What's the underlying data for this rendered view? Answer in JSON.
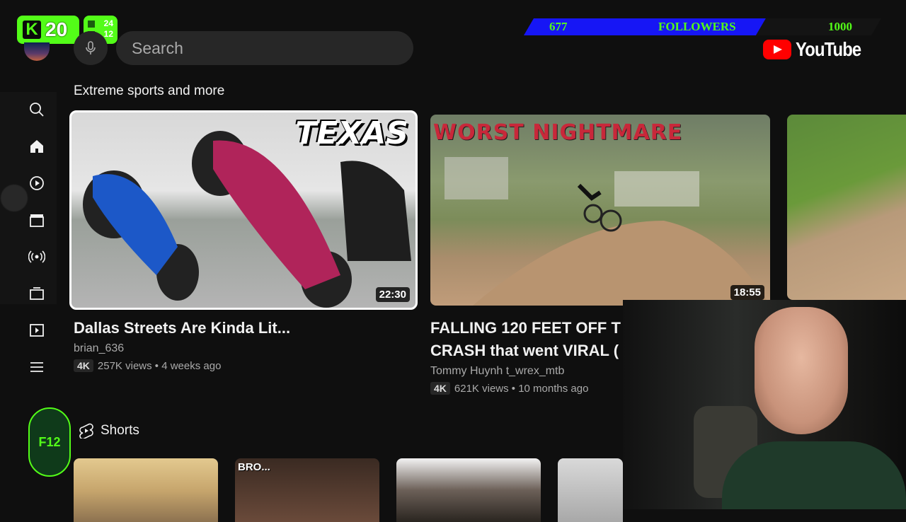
{
  "overlay": {
    "kick_count": "20",
    "stats_top": "24",
    "stats_bottom": "12",
    "followers_current": "677",
    "followers_label": "FOLLOWERS",
    "followers_goal": "1000",
    "followers_progress": 0.677,
    "team_logo_text": "F12"
  },
  "header": {
    "brand": "YouTube",
    "search_placeholder": "Search"
  },
  "rail": {
    "items": [
      "search-icon",
      "home-icon",
      "subscriptions-icon",
      "movies-icon",
      "live-icon",
      "gaming-icon",
      "playlists-icon",
      "menu-icon"
    ]
  },
  "section": {
    "title": "Extreme sports and more"
  },
  "videos": [
    {
      "title": "Dallas Streets Are Kinda Lit...",
      "channel": "brian_636",
      "quality": "4K",
      "meta": "257K views • 4 weeks ago",
      "duration": "22:30",
      "thumb_text": "TEXAS"
    },
    {
      "title_line1": "FALLING 120 FEET OFF T",
      "title_line2": "CRASH that went VIRAL (",
      "channel": "Tommy Huynh t_wrex_mtb",
      "quality": "4K",
      "meta": "621K views • 10 months ago",
      "duration": "18:55",
      "thumb_text": "WORST NIGHTMARE"
    }
  ],
  "shorts": {
    "label": "Shorts",
    "items": [
      {
        "tag": ""
      },
      {
        "tag": "BRO..."
      },
      {
        "tag": ""
      },
      {
        "tag": ""
      }
    ]
  },
  "colors": {
    "background": "#0f0f0f",
    "kick_green": "#53fc18",
    "follow_blue": "#1616f5",
    "youtube_red": "#ff0000"
  }
}
